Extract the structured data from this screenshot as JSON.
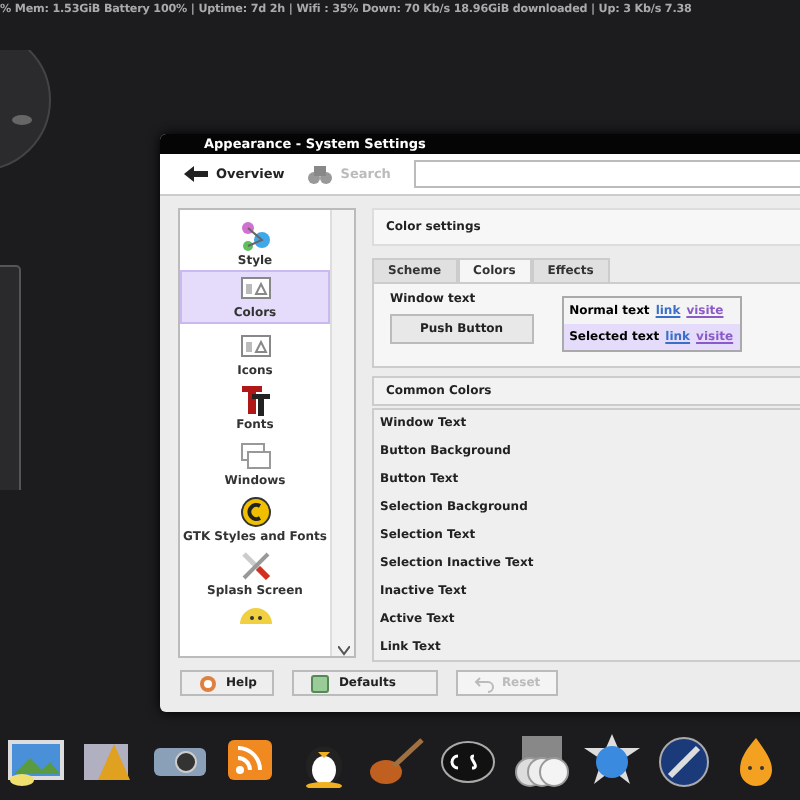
{
  "status_bar": {
    "text": "% Mem: 1.53GiB Battery 100% | Uptime: 7d 2h | Wifi : 35% Down: 70 Kb/s 18.96GiB downloaded | Up: 3 Kb/s 7.38"
  },
  "window": {
    "title": "Appearance - System Settings"
  },
  "toolbar": {
    "back": {
      "label": "Overview"
    },
    "search": {
      "label": "Search",
      "disabled": true
    }
  },
  "sidebar": {
    "items": [
      {
        "label": "Style",
        "selected": false
      },
      {
        "label": "Colors",
        "selected": true
      },
      {
        "label": "Icons",
        "selected": false
      },
      {
        "label": "Fonts",
        "selected": false
      },
      {
        "label": "Windows",
        "selected": false
      },
      {
        "label": "GTK Styles and Fonts",
        "selected": false
      },
      {
        "label": "Splash Screen",
        "selected": false
      }
    ]
  },
  "panel": {
    "heading": "Color settings",
    "tabs": [
      {
        "label": "Scheme",
        "selected": false
      },
      {
        "label": "Colors",
        "selected": true
      },
      {
        "label": "Effects",
        "selected": false
      }
    ],
    "preview": {
      "window_text": "Window text",
      "push_button": "Push Button",
      "rows": [
        {
          "label": "Normal text",
          "link": "link",
          "visited": "visite",
          "selected": false
        },
        {
          "label": "Selected text",
          "link": "link",
          "visited": "visite",
          "selected": true
        }
      ]
    },
    "common_colors": {
      "header": "Common Colors",
      "items": [
        "Window Text",
        "Button Background",
        "Button Text",
        "Selection Background",
        "Selection Text",
        "Selection Inactive Text",
        "Inactive Text",
        "Active Text",
        "Link Text"
      ]
    }
  },
  "buttons": [
    {
      "label": "Help",
      "disabled": false
    },
    {
      "label": "Defaults",
      "disabled": false
    },
    {
      "label": "Reset",
      "disabled": true
    }
  ]
}
